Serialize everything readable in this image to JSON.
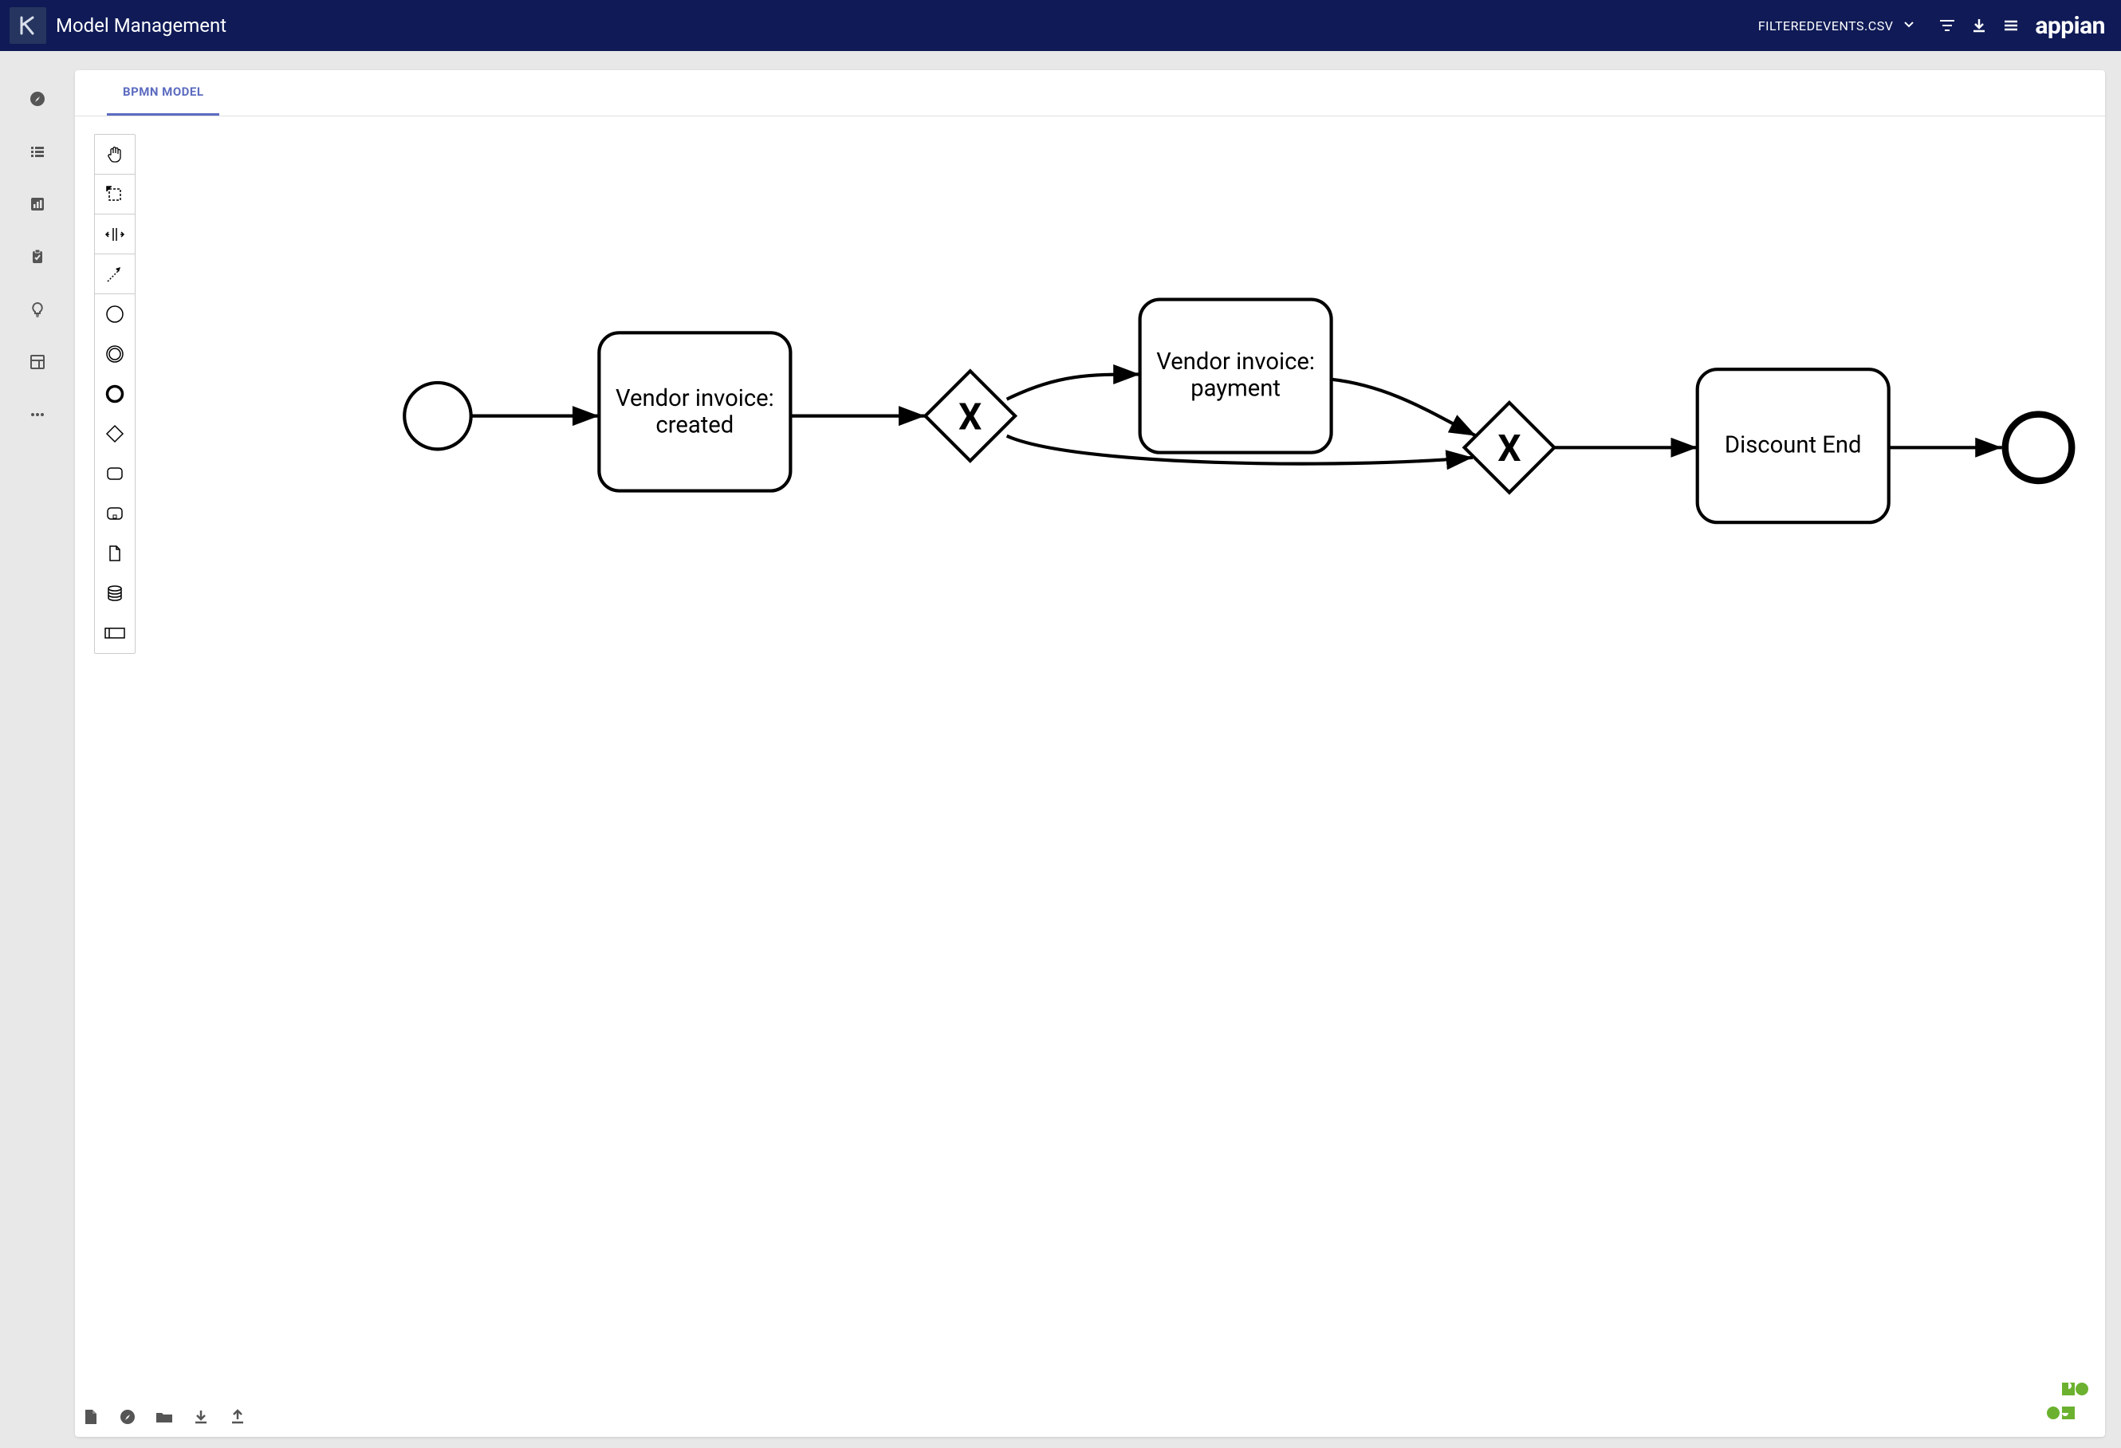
{
  "header": {
    "title": "Model Management",
    "filename": "FILTEREDEVENTS.CSV",
    "brand": "appian"
  },
  "tabs": {
    "bpmn": "BPMN MODEL"
  },
  "diagram": {
    "tasks": {
      "created": "Vendor invoice: created",
      "payment": "Vendor invoice: payment",
      "discount": "Discount End"
    },
    "gateway_marker": "X"
  }
}
